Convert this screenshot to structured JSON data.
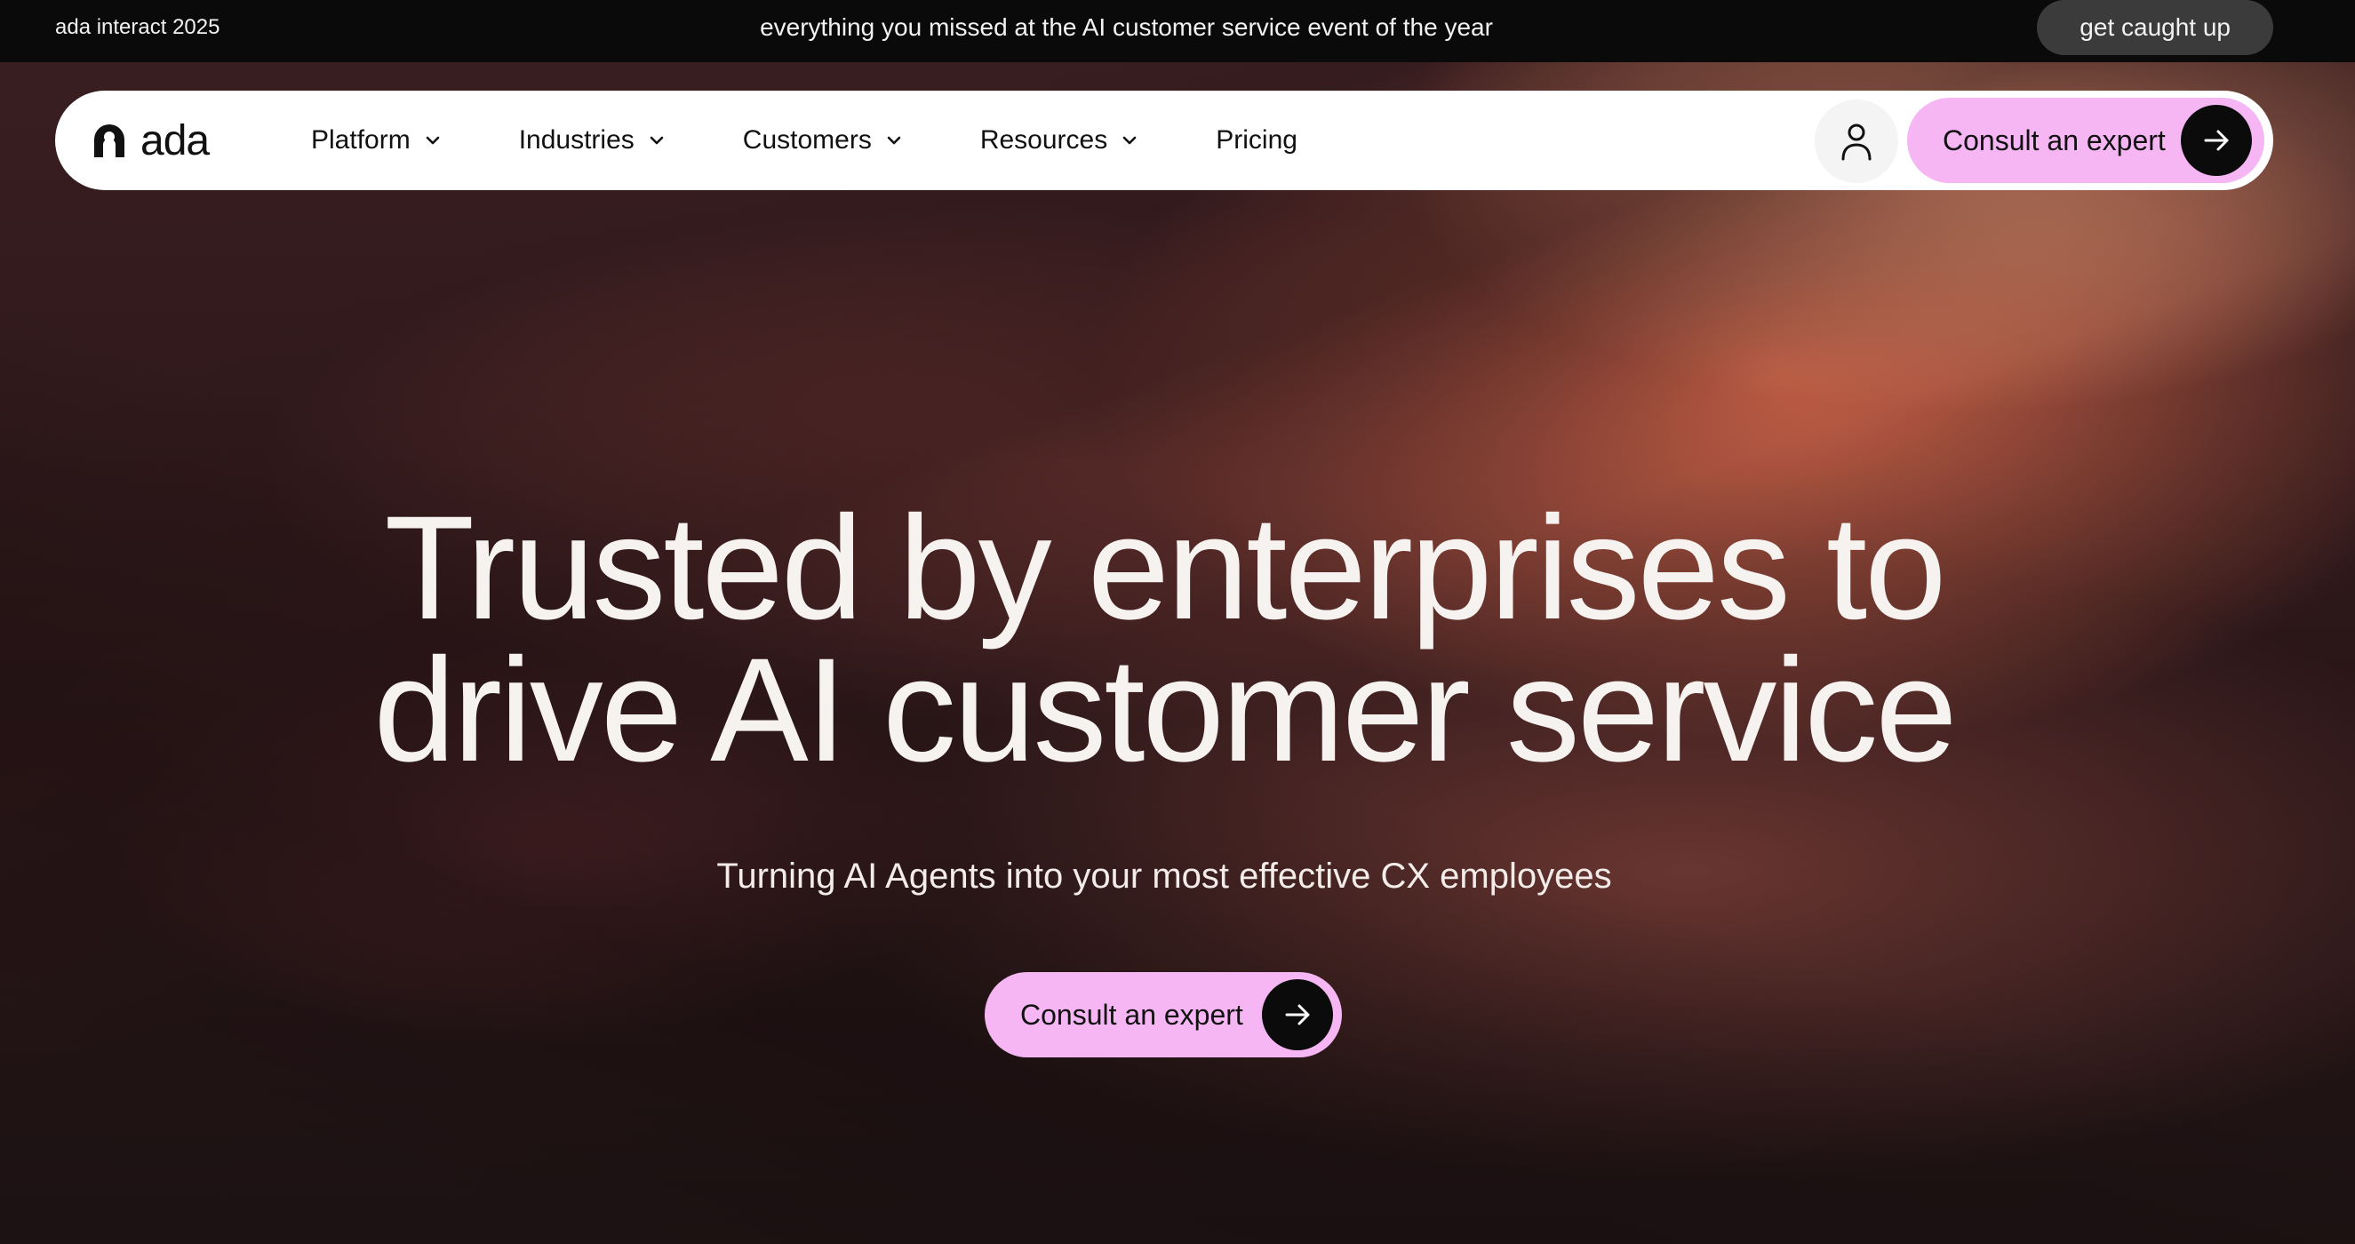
{
  "topbar": {
    "event_label": "ada interact 2025",
    "announcement": "everything you missed at the AI customer service event of the year",
    "catchup_label": "get caught up"
  },
  "nav": {
    "logo_text": "ada",
    "items": [
      {
        "label": "Platform",
        "has_dropdown": true
      },
      {
        "label": "Industries",
        "has_dropdown": true
      },
      {
        "label": "Customers",
        "has_dropdown": true
      },
      {
        "label": "Resources",
        "has_dropdown": true
      },
      {
        "label": "Pricing",
        "has_dropdown": false
      }
    ],
    "user_icon": "user-icon",
    "cta_label": "Consult an expert",
    "cta_icon": "arrow-right-icon"
  },
  "hero": {
    "headline_line1": "Trusted by enterprises to",
    "headline_line2": "drive AI customer service",
    "subheadline": "Turning AI Agents into your most effective CX employees",
    "cta_label": "Consult an expert",
    "cta_icon": "arrow-right-icon"
  },
  "colors": {
    "topbar_bg": "#0b0a0a",
    "cta_pink": "#f6b6f4",
    "arrow_circle": "#0b0b0b",
    "hero_text": "#f6f2f0"
  }
}
